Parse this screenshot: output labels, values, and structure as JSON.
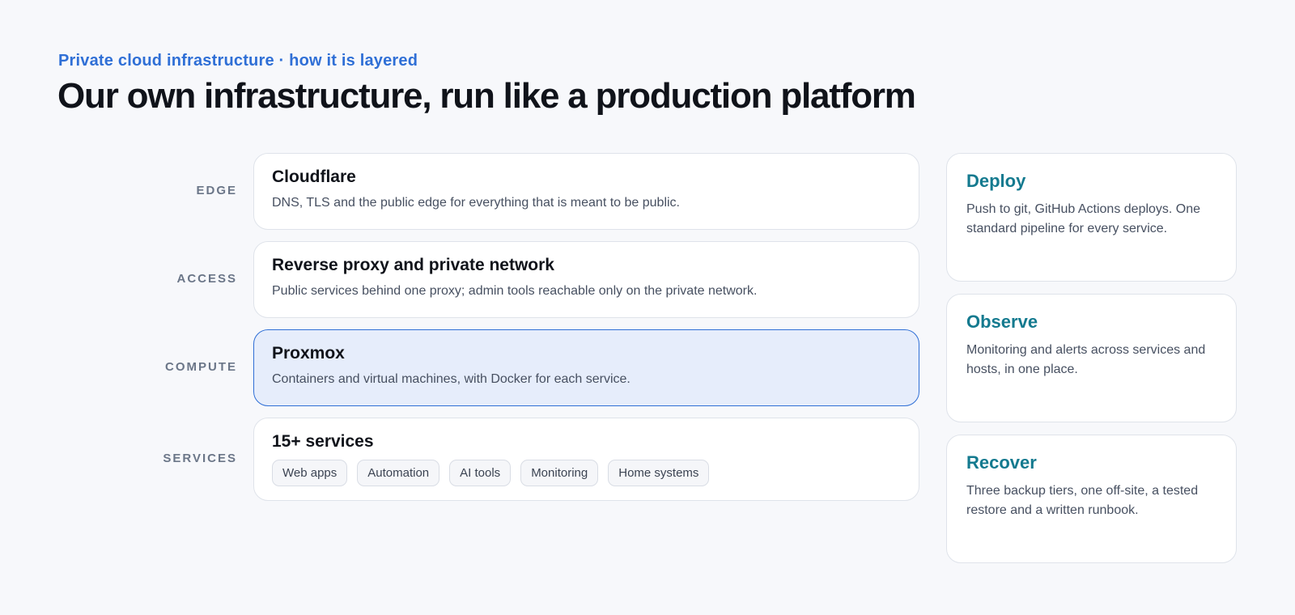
{
  "eyebrow": "Private cloud infrastructure · how it is layered",
  "headline": "Our own infrastructure, run like a production platform",
  "layers": [
    {
      "label": "EDGE",
      "title": "Cloudflare",
      "desc": "DNS, TLS and the public edge for everything that is meant to be public."
    },
    {
      "label": "ACCESS",
      "title": "Reverse proxy and private network",
      "desc": "Public services behind one proxy; admin tools reachable only on the private network."
    },
    {
      "label": "COMPUTE",
      "title": "Proxmox",
      "desc": "Containers and virtual machines, with Docker for each service.",
      "highlighted": true
    },
    {
      "label": "SERVICES",
      "title": "15+ services",
      "chips": [
        "Web apps",
        "Automation",
        "AI tools",
        "Monitoring",
        "Home systems"
      ]
    }
  ],
  "practices": [
    {
      "title": "Deploy",
      "desc": "Push to git, GitHub Actions deploys. One standard pipeline for every service."
    },
    {
      "title": "Observe",
      "desc": "Monitoring and alerts across services and hosts, in one place."
    },
    {
      "title": "Recover",
      "desc": "Three backup tiers, one off-site, a tested restore and a written runbook."
    }
  ],
  "colors": {
    "accent_blue": "#2f6fd6",
    "accent_teal": "#147a8f",
    "highlight_bg": "#e6edfb",
    "page_bg": "#f7f8fb"
  }
}
